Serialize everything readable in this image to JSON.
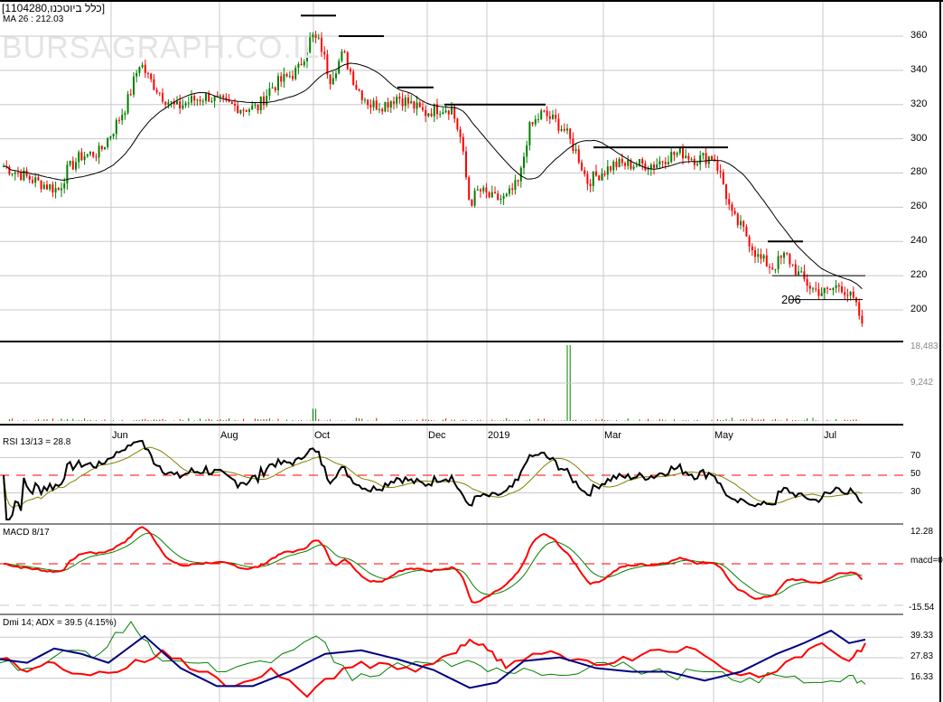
{
  "header": {
    "title": "[1104280,כלל ביוטכנו]",
    "ma_label": "MA 26 : 212.03",
    "watermark": "BURSAGRAPH.CO.IL"
  },
  "chart_data": [
    {
      "type": "candlestick",
      "title": "1104280 price",
      "ylim": [
        186,
        378
      ],
      "yticks": [
        "200",
        "220",
        "240",
        "260",
        "280",
        "300",
        "320",
        "340",
        "360"
      ],
      "xticks": [
        "Jun",
        "Aug",
        "Oct",
        "Dec",
        "2019",
        "Mar",
        "May",
        "Jul"
      ],
      "close_path": [
        [
          0,
          285
        ],
        [
          20,
          280
        ],
        [
          40,
          275
        ],
        [
          65,
          270
        ],
        [
          75,
          282
        ],
        [
          90,
          290
        ],
        [
          110,
          292
        ],
        [
          125,
          305
        ],
        [
          140,
          320
        ],
        [
          155,
          345
        ],
        [
          165,
          335
        ],
        [
          180,
          325
        ],
        [
          195,
          318
        ],
        [
          210,
          322
        ],
        [
          230,
          325
        ],
        [
          250,
          320
        ],
        [
          270,
          318
        ],
        [
          285,
          318
        ],
        [
          300,
          330
        ],
        [
          315,
          335
        ],
        [
          330,
          340
        ],
        [
          345,
          360
        ],
        [
          355,
          355
        ],
        [
          365,
          335
        ],
        [
          380,
          350
        ],
        [
          395,
          330
        ],
        [
          410,
          320
        ],
        [
          425,
          320
        ],
        [
          440,
          325
        ],
        [
          455,
          320
        ],
        [
          470,
          315
        ],
        [
          485,
          318
        ],
        [
          500,
          318
        ],
        [
          510,
          300
        ],
        [
          520,
          262
        ],
        [
          530,
          270
        ],
        [
          545,
          265
        ],
        [
          560,
          265
        ],
        [
          575,
          275
        ],
        [
          585,
          305
        ],
        [
          600,
          315
        ],
        [
          615,
          310
        ],
        [
          625,
          305
        ],
        [
          640,
          290
        ],
        [
          650,
          275
        ],
        [
          665,
          280
        ],
        [
          680,
          285
        ],
        [
          695,
          285
        ],
        [
          710,
          285
        ],
        [
          725,
          285
        ],
        [
          740,
          290
        ],
        [
          755,
          292
        ],
        [
          770,
          288
        ],
        [
          790,
          290
        ],
        [
          800,
          275
        ],
        [
          810,
          255
        ],
        [
          825,
          245
        ],
        [
          840,
          230
        ],
        [
          855,
          225
        ],
        [
          870,
          232
        ],
        [
          885,
          220
        ],
        [
          900,
          212
        ],
        [
          915,
          210
        ],
        [
          930,
          215
        ],
        [
          945,
          205
        ],
        [
          955,
          192
        ]
      ],
      "ma_period": 26,
      "levels": [
        {
          "price": 372,
          "from": 333,
          "to": 372
        },
        {
          "price": 360,
          "from": 375,
          "to": 425
        },
        {
          "price": 330,
          "from": 440,
          "to": 480
        },
        {
          "price": 320,
          "from": 492,
          "to": 604
        },
        {
          "price": 295,
          "from": 657,
          "to": 806
        },
        {
          "price": 240,
          "from": 850,
          "to": 889
        },
        {
          "price": 220,
          "from": 855,
          "to": 958
        },
        {
          "price": 206,
          "from": 873,
          "to": 955
        }
      ],
      "annotation": "206"
    },
    {
      "type": "bar",
      "title": "Volume",
      "yticks": [
        "18,483",
        "9,242"
      ],
      "max": 18483,
      "spike_index": 630,
      "spike_value": 18483
    },
    {
      "type": "line",
      "title": "RSI 13/13 = 28.8",
      "yticks": [
        "70",
        "50",
        "30"
      ],
      "ylim": [
        0,
        100
      ]
    },
    {
      "type": "line",
      "title": "MACD 8/17",
      "yticks": [
        "12.28",
        "macd=0",
        "-15.54"
      ],
      "ylim": [
        -15.54,
        12.28
      ]
    },
    {
      "type": "line",
      "title": "Dmi 14; ADX = 39.5 (4.15%)",
      "yticks": [
        "39.33",
        "27.83",
        "16.33"
      ],
      "adx": [
        [
          0,
          27
        ],
        [
          30,
          25
        ],
        [
          60,
          33
        ],
        [
          90,
          30
        ],
        [
          120,
          25
        ],
        [
          160,
          40
        ],
        [
          200,
          22
        ],
        [
          240,
          12
        ],
        [
          280,
          12
        ],
        [
          320,
          20
        ],
        [
          360,
          30
        ],
        [
          400,
          32
        ],
        [
          440,
          27
        ],
        [
          480,
          21
        ],
        [
          520,
          11
        ],
        [
          550,
          14
        ],
        [
          580,
          26
        ],
        [
          620,
          28
        ],
        [
          660,
          22
        ],
        [
          700,
          20
        ],
        [
          740,
          20
        ],
        [
          780,
          15
        ],
        [
          820,
          20
        ],
        [
          860,
          30
        ],
        [
          890,
          36
        ],
        [
          920,
          43
        ],
        [
          940,
          36
        ],
        [
          958,
          38
        ]
      ],
      "plus_di": [
        [
          0,
          27
        ],
        [
          30,
          20
        ],
        [
          60,
          25
        ],
        [
          100,
          18
        ],
        [
          140,
          22
        ],
        [
          180,
          32
        ],
        [
          220,
          20
        ],
        [
          260,
          12
        ],
        [
          300,
          22
        ],
        [
          340,
          6
        ],
        [
          380,
          22
        ],
        [
          420,
          25
        ],
        [
          460,
          20
        ],
        [
          500,
          30
        ],
        [
          520,
          38
        ],
        [
          540,
          32
        ],
        [
          560,
          22
        ],
        [
          600,
          30
        ],
        [
          640,
          27
        ],
        [
          680,
          25
        ],
        [
          720,
          32
        ],
        [
          760,
          34
        ],
        [
          800,
          22
        ],
        [
          840,
          17
        ],
        [
          880,
          28
        ],
        [
          910,
          36
        ],
        [
          940,
          26
        ],
        [
          958,
          36
        ]
      ],
      "minus_di": [
        [
          0,
          25
        ],
        [
          40,
          22
        ],
        [
          80,
          32
        ],
        [
          110,
          30
        ],
        [
          145,
          48
        ],
        [
          170,
          30
        ],
        [
          210,
          25
        ],
        [
          250,
          20
        ],
        [
          300,
          25
        ],
        [
          350,
          40
        ],
        [
          390,
          15
        ],
        [
          430,
          22
        ],
        [
          470,
          25
        ],
        [
          510,
          25
        ],
        [
          540,
          20
        ],
        [
          580,
          22
        ],
        [
          620,
          18
        ],
        [
          660,
          25
        ],
        [
          700,
          22
        ],
        [
          740,
          18
        ],
        [
          780,
          20
        ],
        [
          820,
          14
        ],
        [
          860,
          18
        ],
        [
          900,
          14
        ],
        [
          940,
          18
        ],
        [
          958,
          13
        ]
      ]
    }
  ]
}
